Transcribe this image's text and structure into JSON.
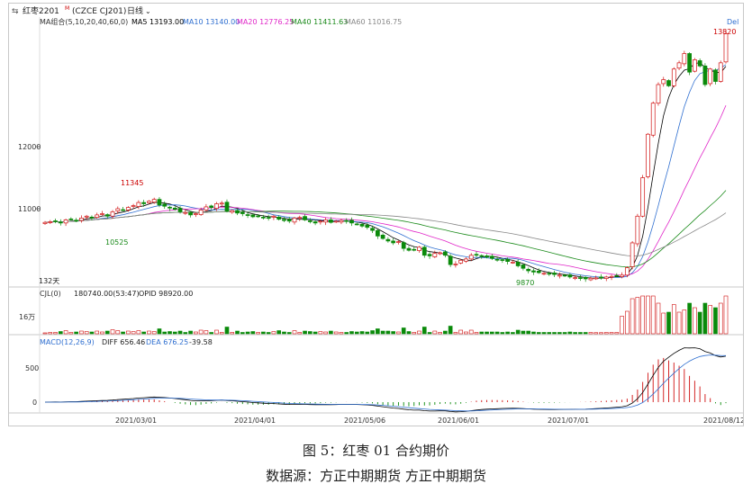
{
  "header": {
    "instrument": "红枣2201",
    "instrument_sup": "M",
    "code": "(CZCE CJ201)",
    "period": "日线"
  },
  "ma_legend": {
    "title": "MA组合(5,10,20,40,60,0)",
    "items": [
      {
        "label": "MA5 13193.00",
        "color": "#000000"
      },
      {
        "label": "MA10 13140.00",
        "color": "#2f6fd0"
      },
      {
        "label": "MA20 12776.25",
        "color": "#e026c8"
      },
      {
        "label": "MA40 11411.63",
        "color": "#1a8a1a"
      },
      {
        "label": "MA60 11016.75",
        "color": "#888888"
      }
    ]
  },
  "vol_legend": {
    "title": "CJL(0)",
    "value": "180740.00(53:47)",
    "opid": "OPID 98920.00"
  },
  "macd_legend": {
    "title": "MACD(12,26,9)",
    "diff": "DIFF 656.46",
    "dea": "DEA 676.25",
    "macd": "-39.58"
  },
  "corner_label": "Del",
  "range_label": "132天",
  "price_axis": [
    "12000",
    "11000"
  ],
  "vol_axis": [
    "16万"
  ],
  "macd_axis": [
    "500",
    "0"
  ],
  "date_axis": [
    "2021/03/01",
    "2021/04/01",
    "2021/05/06",
    "2021/06/01",
    "2021/07/01",
    "2021/08/12"
  ],
  "annotations": {
    "high1": "11345",
    "low1": "10525",
    "low2": "9870",
    "high2": "13820"
  },
  "captions": {
    "figure": "图 5：红枣 01 合约期价",
    "source": "数据源：方正中期期货  方正中期期货"
  },
  "chart_data": {
    "type": "candlestick",
    "title": "红枣2201 (CZCE CJ201) 日线",
    "bars": 132,
    "ylim": [
      9550,
      14000
    ],
    "close": [
      10780,
      10790,
      10800,
      10770,
      10820,
      10830,
      10810,
      10850,
      10880,
      10860,
      10900,
      10920,
      10880,
      10950,
      11000,
      10980,
      11020,
      11050,
      11100,
      11080,
      11120,
      11150,
      11060,
      11040,
      11010,
      10990,
      10950,
      10940,
      10900,
      10920,
      10980,
      11030,
      11020,
      11080,
      11090,
      10960,
      10970,
      10930,
      10920,
      10900,
      10870,
      10880,
      10860,
      10850,
      10880,
      10830,
      10810,
      10800,
      10850,
      10860,
      10820,
      10790,
      10770,
      10800,
      10820,
      10780,
      10800,
      10810,
      10800,
      10770,
      10750,
      10720,
      10700,
      10650,
      10560,
      10520,
      10480,
      10450,
      10470,
      10360,
      10330,
      10340,
      10380,
      10250,
      10240,
      10280,
      10290,
      10250,
      10100,
      10110,
      10170,
      10190,
      10250,
      10260,
      10240,
      10220,
      10200,
      10180,
      10170,
      10150,
      10140,
      10080,
      10040,
      10000,
      9980,
      9970,
      9960,
      9950,
      9940,
      9930,
      9920,
      9900,
      9890,
      9880,
      9870,
      9880,
      9885,
      9890,
      9900,
      9910,
      9920,
      9930,
      10050,
      10450,
      10880,
      11500,
      12200,
      12700,
      13000,
      13080,
      12980,
      13250,
      13350,
      13500,
      13200,
      13400,
      13300,
      13000,
      13250,
      13050,
      13350,
      13820
    ],
    "high_points": [
      {
        "label": "11345",
        "price": 11345
      },
      {
        "label": "13820",
        "price": 13820
      }
    ],
    "low_points": [
      {
        "label": "10525",
        "price": 10525
      },
      {
        "label": "9870",
        "price": 9870
      }
    ],
    "ma_last": {
      "MA5": 13193.0,
      "MA10": 13140.0,
      "MA20": 12776.25,
      "MA40": 11411.63,
      "MA60": 11016.75
    },
    "volume_last": 180740.0,
    "opid": 98920.0,
    "macd_last": {
      "DIFF": 656.46,
      "DEA": 676.25,
      "MACD": -39.58
    },
    "x_ticks": [
      "2021/03/01",
      "2021/04/01",
      "2021/05/06",
      "2021/06/01",
      "2021/07/01",
      "2021/08/12"
    ],
    "y_ticks": [
      12000,
      11000
    ]
  }
}
